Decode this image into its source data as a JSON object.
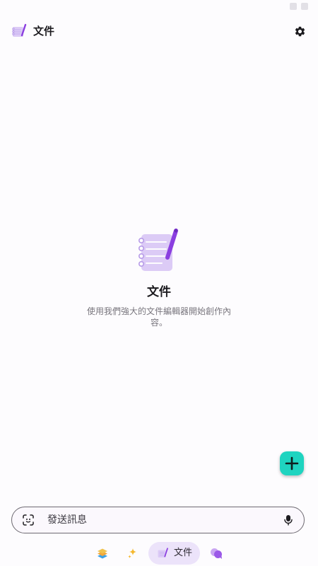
{
  "header": {
    "title": "文件"
  },
  "empty_state": {
    "title": "文件",
    "description": "使用我們強大的文件編輯器開始創作內容。"
  },
  "composer": {
    "placeholder": "發送訊息"
  },
  "bottom_nav": {
    "items": [
      {
        "icon": "layers-icon",
        "label": ""
      },
      {
        "icon": "sparkle-icon",
        "label": ""
      },
      {
        "icon": "document-icon",
        "label": "文件",
        "active": true
      },
      {
        "icon": "chat-bubbles-icon",
        "label": ""
      }
    ]
  },
  "colors": {
    "accent": "#8b3fe0",
    "fab": "#1fd4c0",
    "nav_active_bg": "#ece3fa",
    "paper": "#dccbf6"
  }
}
